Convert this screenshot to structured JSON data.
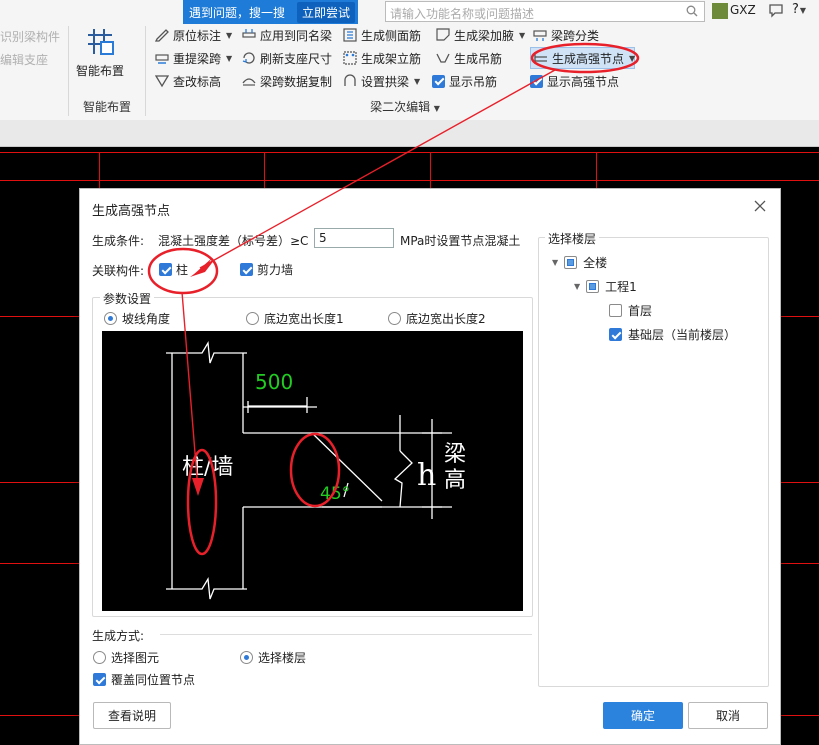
{
  "help": {
    "text": "遇到问题，搜一搜",
    "try_label": "立即尝试",
    "search_placeholder": "请输入功能名称或问题描述"
  },
  "user": {
    "name": "GXZ",
    "help_mark": "?"
  },
  "ribbon": {
    "left_items": [
      "识别梁构件",
      "编辑支座"
    ],
    "smart_layout_label": "智能布置",
    "smart_layout_group": "智能布置",
    "col1": [
      "原位标注",
      "重提梁跨",
      "查改标高"
    ],
    "col2": [
      "应用到同名梁",
      "刷新支座尺寸",
      "梁跨数据复制"
    ],
    "col3": [
      "生成侧面筋",
      "生成架立筋",
      "设置拱梁"
    ],
    "col4": [
      "生成梁加腋",
      "生成吊筋",
      "显示吊筋"
    ],
    "col5": [
      "梁跨分类",
      "生成高强节点",
      "显示高强节点"
    ],
    "group_label": "梁二次编辑"
  },
  "dialog": {
    "title": "生成高强节点",
    "condition_label": "生成条件:",
    "condition_text": "混凝土强度差（标号差）≥C",
    "condition_value": "5",
    "condition_suffix": "MPa时设置节点混凝土",
    "related_label": "关联构件:",
    "column_label": "柱",
    "shearwall_label": "剪力墙",
    "params_legend": "参数设置",
    "radio_slope": "坡线角度",
    "radio_edge1": "底边宽出长度1",
    "radio_edge2": "底边宽出长度2",
    "diagram": {
      "dim_value": "500",
      "angle_value": "45°",
      "column_wall": "柱/墙",
      "h_label": "h",
      "beam_label": "梁",
      "height_label": "高"
    },
    "gen_method_label": "生成方式:",
    "radio_select_element": "选择图元",
    "radio_select_floor": "选择楼层",
    "override_label": "覆盖同位置节点",
    "floor_legend": "选择楼层",
    "tree": {
      "all": "全楼",
      "project": "工程1",
      "floor1": "首层",
      "foundation": "基础层（当前楼层）"
    },
    "view_help": "查看说明",
    "ok": "确定",
    "cancel": "取消"
  }
}
